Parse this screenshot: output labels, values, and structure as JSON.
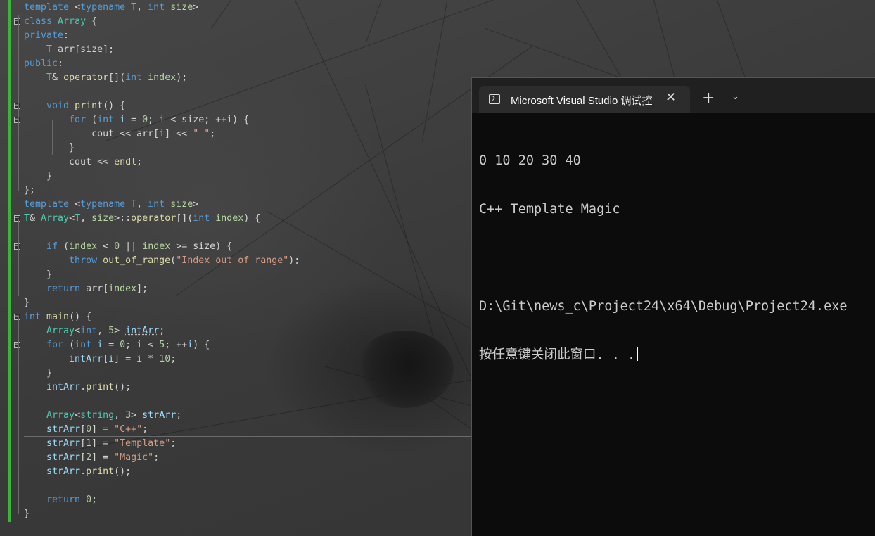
{
  "editor": {
    "lines": [
      [
        [
          "kw",
          "template "
        ],
        [
          "plain",
          "<"
        ],
        [
          "kw",
          "typename "
        ],
        [
          "ty",
          "T"
        ],
        [
          "plain",
          ", "
        ],
        [
          "kw",
          "int "
        ],
        [
          "pm",
          "size"
        ],
        [
          "plain",
          ">"
        ]
      ],
      [
        [
          "kw",
          "class "
        ],
        [
          "ty",
          "Array "
        ],
        [
          "plain",
          "{"
        ]
      ],
      [
        [
          "kw",
          "private"
        ],
        [
          "plain",
          ":"
        ]
      ],
      [
        [
          "plain",
          "    "
        ],
        [
          "ty",
          "T "
        ],
        [
          "plain",
          "arr[size];"
        ]
      ],
      [
        [
          "kw",
          "public"
        ],
        [
          "plain",
          ":"
        ]
      ],
      [
        [
          "plain",
          "    "
        ],
        [
          "ty",
          "T"
        ],
        [
          "plain",
          "& "
        ],
        [
          "fn",
          "operator"
        ],
        [
          "plain",
          "[]("
        ],
        [
          "kw",
          "int "
        ],
        [
          "pm",
          "index"
        ],
        [
          "plain",
          ");"
        ]
      ],
      [
        [
          "plain",
          ""
        ]
      ],
      [
        [
          "plain",
          "    "
        ],
        [
          "kw",
          "void "
        ],
        [
          "fn",
          "print"
        ],
        [
          "plain",
          "() {"
        ]
      ],
      [
        [
          "plain",
          "        "
        ],
        [
          "kw",
          "for "
        ],
        [
          "plain",
          "("
        ],
        [
          "kw",
          "int "
        ],
        [
          "var",
          "i "
        ],
        [
          "plain",
          "= "
        ],
        [
          "num",
          "0"
        ],
        [
          "plain",
          "; "
        ],
        [
          "var",
          "i "
        ],
        [
          "plain",
          "< size; ++"
        ],
        [
          "var",
          "i"
        ],
        [
          "plain",
          ") {"
        ]
      ],
      [
        [
          "plain",
          "            cout << arr["
        ],
        [
          "var",
          "i"
        ],
        [
          "plain",
          "] << "
        ],
        [
          "str",
          "\" \""
        ],
        [
          "plain",
          ";"
        ]
      ],
      [
        [
          "plain",
          "        }"
        ]
      ],
      [
        [
          "plain",
          "        cout << "
        ],
        [
          "fn",
          "endl"
        ],
        [
          "plain",
          ";"
        ]
      ],
      [
        [
          "plain",
          "    }"
        ]
      ],
      [
        [
          "plain",
          "};"
        ]
      ],
      [
        [
          "kw",
          "template "
        ],
        [
          "plain",
          "<"
        ],
        [
          "kw",
          "typename "
        ],
        [
          "ty",
          "T"
        ],
        [
          "plain",
          ", "
        ],
        [
          "kw",
          "int "
        ],
        [
          "pm",
          "size"
        ],
        [
          "plain",
          ">"
        ]
      ],
      [
        [
          "ty",
          "T"
        ],
        [
          "plain",
          "& "
        ],
        [
          "ty",
          "Array"
        ],
        [
          "plain",
          "<"
        ],
        [
          "ty",
          "T"
        ],
        [
          "plain",
          ", "
        ],
        [
          "pm",
          "size"
        ],
        [
          "plain",
          ">::"
        ],
        [
          "fn",
          "operator"
        ],
        [
          "plain",
          "[]("
        ],
        [
          "kw",
          "int "
        ],
        [
          "pm",
          "index"
        ],
        [
          "plain",
          ") {"
        ]
      ],
      [
        [
          "plain",
          ""
        ]
      ],
      [
        [
          "plain",
          "    "
        ],
        [
          "kw",
          "if "
        ],
        [
          "plain",
          "("
        ],
        [
          "pm",
          "index "
        ],
        [
          "plain",
          "< "
        ],
        [
          "num",
          "0 "
        ],
        [
          "plain",
          "|| "
        ],
        [
          "pm",
          "index "
        ],
        [
          "plain",
          ">= size) {"
        ]
      ],
      [
        [
          "plain",
          "        "
        ],
        [
          "kw",
          "throw "
        ],
        [
          "fn",
          "out_of_range"
        ],
        [
          "plain",
          "("
        ],
        [
          "str",
          "\"Index out of range\""
        ],
        [
          "plain",
          ");"
        ]
      ],
      [
        [
          "plain",
          "    }"
        ]
      ],
      [
        [
          "plain",
          "    "
        ],
        [
          "kw",
          "return "
        ],
        [
          "plain",
          "arr["
        ],
        [
          "pm",
          "index"
        ],
        [
          "plain",
          "];"
        ]
      ],
      [
        [
          "plain",
          "}"
        ]
      ],
      [
        [
          "kw",
          "int "
        ],
        [
          "fn",
          "main"
        ],
        [
          "plain",
          "() {"
        ]
      ],
      [
        [
          "plain",
          "    "
        ],
        [
          "ty",
          "Array"
        ],
        [
          "plain",
          "<"
        ],
        [
          "kw",
          "int"
        ],
        [
          "plain",
          ", "
        ],
        [
          "num",
          "5"
        ],
        [
          "plain",
          "> "
        ],
        [
          "var",
          "intArr"
        ],
        [
          "plain",
          ";"
        ]
      ],
      [
        [
          "plain",
          "    "
        ],
        [
          "kw",
          "for "
        ],
        [
          "plain",
          "("
        ],
        [
          "kw",
          "int "
        ],
        [
          "var",
          "i "
        ],
        [
          "plain",
          "= "
        ],
        [
          "num",
          "0"
        ],
        [
          "plain",
          "; "
        ],
        [
          "var",
          "i "
        ],
        [
          "plain",
          "< "
        ],
        [
          "num",
          "5"
        ],
        [
          "plain",
          "; ++"
        ],
        [
          "var",
          "i"
        ],
        [
          "plain",
          ") {"
        ]
      ],
      [
        [
          "plain",
          "        "
        ],
        [
          "var",
          "intArr"
        ],
        [
          "plain",
          "["
        ],
        [
          "var",
          "i"
        ],
        [
          "plain",
          "] = "
        ],
        [
          "var",
          "i "
        ],
        [
          "plain",
          "* "
        ],
        [
          "num",
          "10"
        ],
        [
          "plain",
          ";"
        ]
      ],
      [
        [
          "plain",
          "    }"
        ]
      ],
      [
        [
          "plain",
          "    "
        ],
        [
          "var",
          "intArr"
        ],
        [
          "plain",
          "."
        ],
        [
          "fn",
          "print"
        ],
        [
          "plain",
          "();"
        ]
      ],
      [
        [
          "plain",
          ""
        ]
      ],
      [
        [
          "plain",
          "    "
        ],
        [
          "ty",
          "Array"
        ],
        [
          "plain",
          "<"
        ],
        [
          "ty",
          "string"
        ],
        [
          "plain",
          ", "
        ],
        [
          "num",
          "3"
        ],
        [
          "plain",
          "> "
        ],
        [
          "var",
          "strArr"
        ],
        [
          "plain",
          ";"
        ]
      ],
      [
        [
          "plain",
          "    "
        ],
        [
          "var",
          "strArr"
        ],
        [
          "plain",
          "["
        ],
        [
          "num",
          "0"
        ],
        [
          "plain",
          "] = "
        ],
        [
          "str",
          "\"C++\""
        ],
        [
          "plain",
          ";"
        ]
      ],
      [
        [
          "plain",
          "    "
        ],
        [
          "var",
          "strArr"
        ],
        [
          "plain",
          "["
        ],
        [
          "num",
          "1"
        ],
        [
          "plain",
          "] = "
        ],
        [
          "str",
          "\"Template\""
        ],
        [
          "plain",
          ";"
        ]
      ],
      [
        [
          "plain",
          "    "
        ],
        [
          "var",
          "strArr"
        ],
        [
          "plain",
          "["
        ],
        [
          "num",
          "2"
        ],
        [
          "plain",
          "] = "
        ],
        [
          "str",
          "\"Magic\""
        ],
        [
          "plain",
          ";"
        ]
      ],
      [
        [
          "plain",
          "    "
        ],
        [
          "var",
          "strArr"
        ],
        [
          "plain",
          "."
        ],
        [
          "fn",
          "print"
        ],
        [
          "plain",
          "();"
        ]
      ],
      [
        [
          "plain",
          ""
        ]
      ],
      [
        [
          "plain",
          "    "
        ],
        [
          "kw",
          "return "
        ],
        [
          "num",
          "0"
        ],
        [
          "plain",
          ";"
        ]
      ],
      [
        [
          "plain",
          "}"
        ]
      ]
    ],
    "fold_marker": "−",
    "colors": {
      "keyword": "#569cd6",
      "type": "#4ec9b0",
      "function": "#dcdcaa",
      "string": "#d69d85",
      "number": "#b5cea8",
      "text": "#d4d4d4",
      "gutter_accent": "#3cb43c"
    }
  },
  "terminal": {
    "tab_title": "Microsoft Visual Studio 调试控",
    "tab_icon": "terminal-icon",
    "close_icon": "✕",
    "new_tab_icon": "+",
    "dropdown_icon": "⌄",
    "output_lines": [
      "0 10 20 30 40",
      "C++ Template Magic",
      "",
      "D:\\Git\\news_c\\Project24\\x64\\Debug\\Project24.exe",
      "按任意键关闭此窗口. . ."
    ],
    "colors": {
      "background": "#0c0c0c",
      "titlebar": "#202020",
      "text": "#cccccc"
    }
  }
}
